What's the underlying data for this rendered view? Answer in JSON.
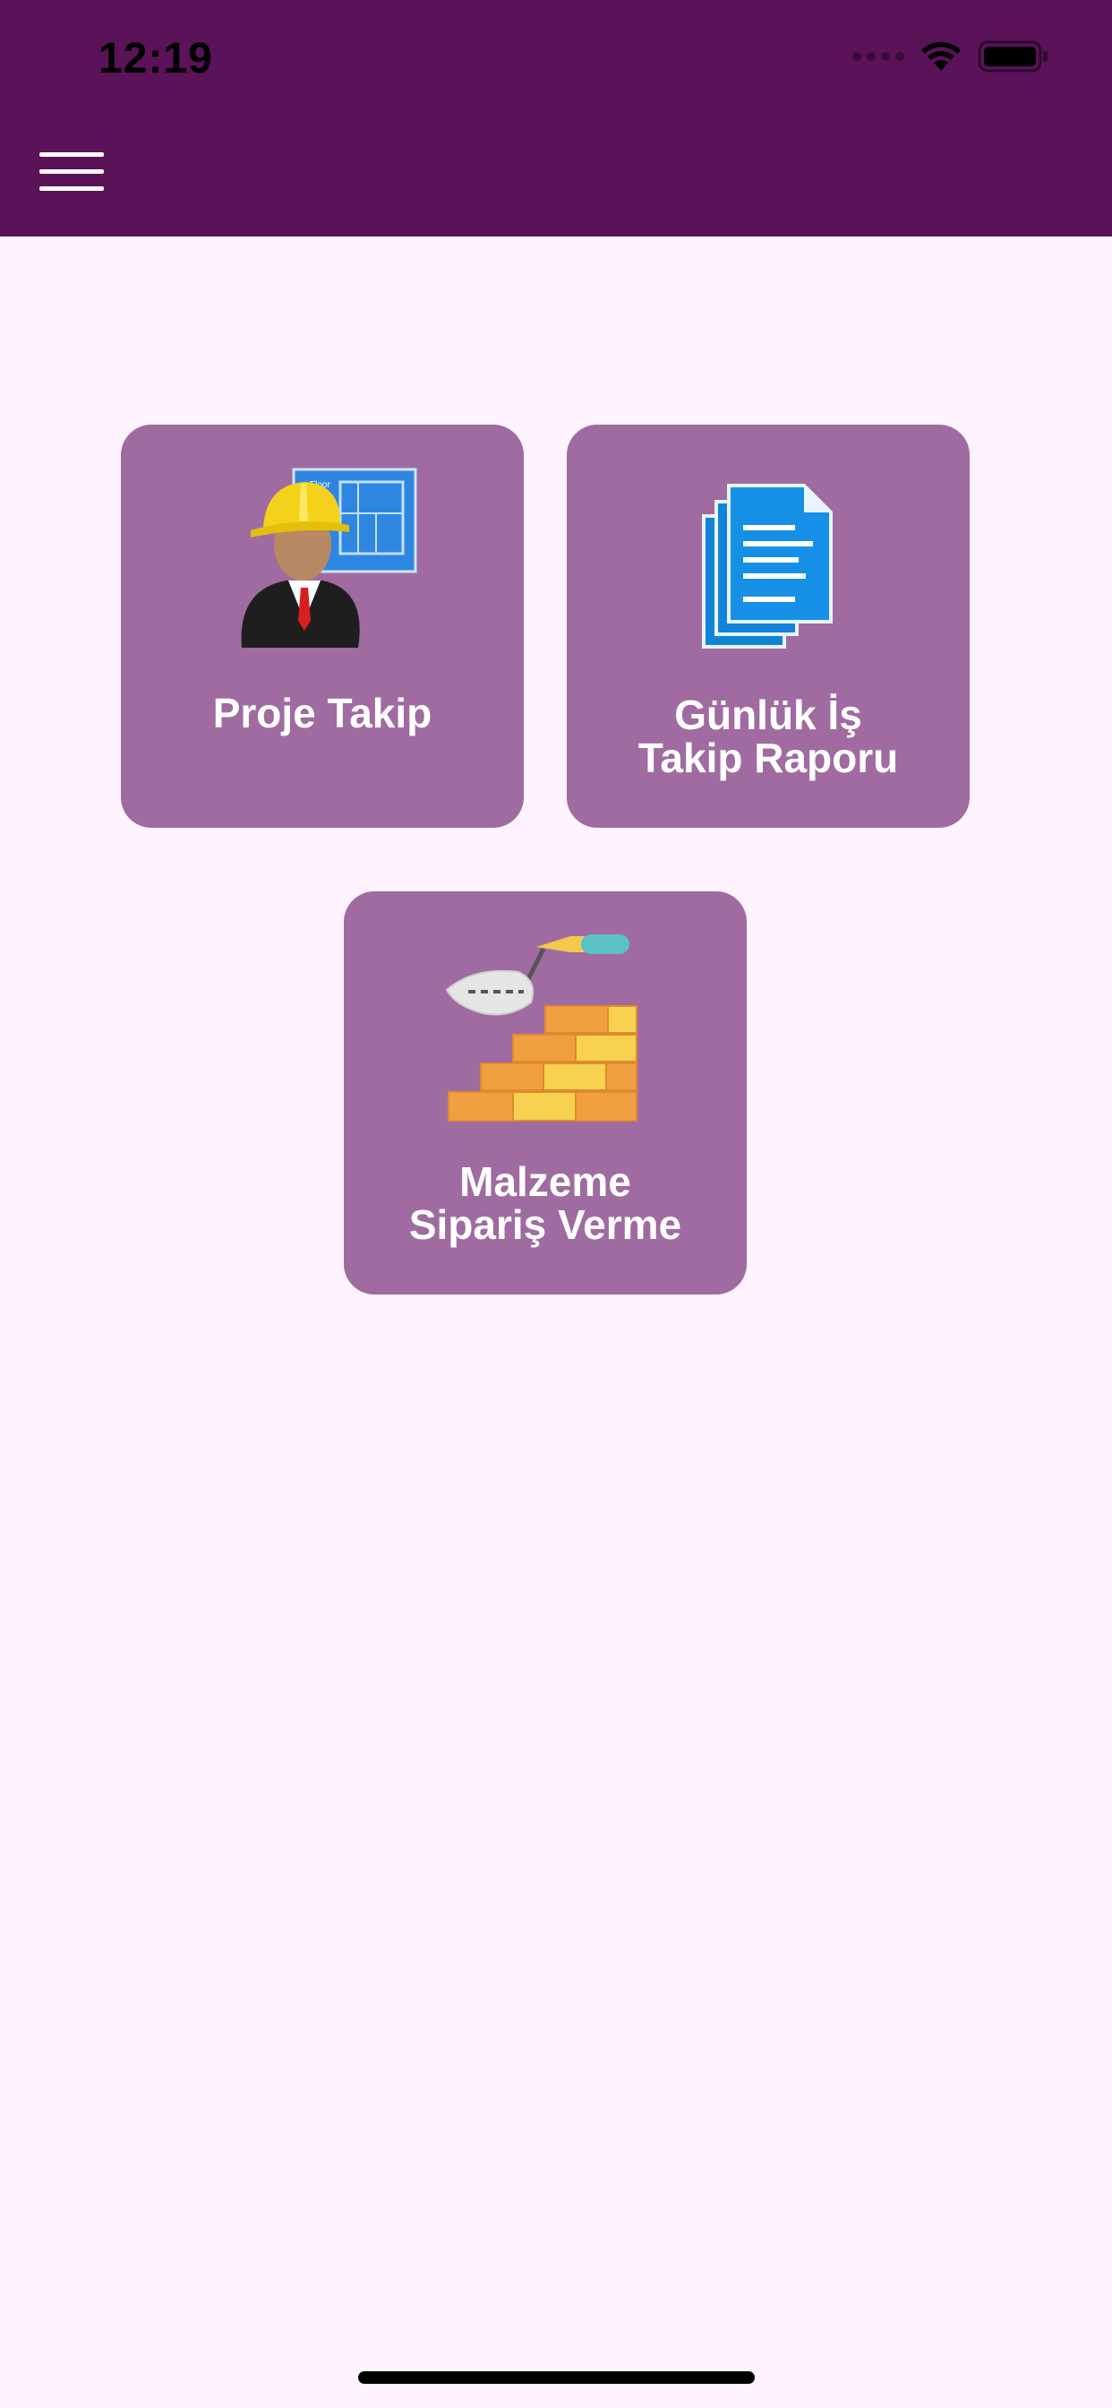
{
  "status_bar": {
    "time": "12:19"
  },
  "header": {
    "menu_icon": "hamburger-menu-icon",
    "background_color": "#5A1259"
  },
  "tiles": [
    {
      "label": "Proje Takip",
      "icon": "construction-worker-blueprint-icon"
    },
    {
      "label_line1": "Günlük İş",
      "label_line2": "Takip Raporu",
      "icon": "documents-icon"
    },
    {
      "label_line1": "Malzeme",
      "label_line2": "Sipariş Verme",
      "icon": "bricks-trowel-icon"
    }
  ],
  "colors": {
    "tile_background": "#9F6BA0",
    "page_background": "#FFF3FF",
    "tile_text": "#FFFFFF"
  }
}
